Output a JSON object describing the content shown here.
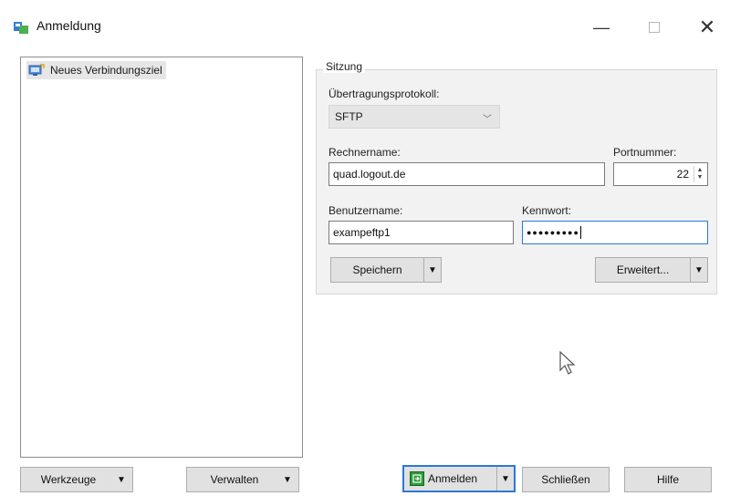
{
  "window": {
    "title": "Anmeldung",
    "controls": {
      "minimize": "—",
      "close": "✕"
    }
  },
  "tree": {
    "items": [
      {
        "label": "Neues Verbindungsziel",
        "icon": "new-site-icon"
      }
    ]
  },
  "session": {
    "group_title": "Sitzung",
    "protocol": {
      "label": "Übertragungsprotokoll:",
      "value": "SFTP"
    },
    "host": {
      "label": "Rechnername:",
      "value": "quad.logout.de"
    },
    "port": {
      "label": "Portnummer:",
      "value": "22"
    },
    "username": {
      "label": "Benutzername:",
      "value": "exampeftp1"
    },
    "password": {
      "label": "Kennwort:",
      "value": "●●●●●●●●●"
    },
    "save_button": "Speichern",
    "advanced_button": "Erweitert..."
  },
  "footer": {
    "tools_button": "Werkzeuge",
    "manage_button": "Verwalten",
    "login_button": "Anmelden",
    "close_button": "Schließen",
    "help_button": "Hilfe"
  },
  "colors": {
    "accent": "#2b79d6",
    "group_bg": "#f2f2f2",
    "button_bg": "#e1e1e1"
  }
}
